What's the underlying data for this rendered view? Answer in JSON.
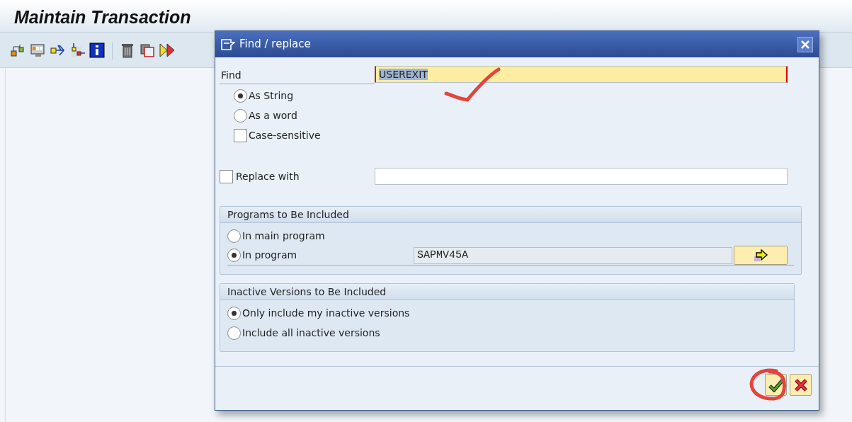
{
  "window": {
    "title": "Maintain Transaction"
  },
  "dialog": {
    "title": "Find / replace",
    "find": {
      "label": "Find",
      "value": "USEREXIT",
      "text_selected": true
    },
    "find_options": [
      {
        "kind": "radio",
        "label": "As String",
        "selected": true
      },
      {
        "kind": "radio",
        "label": "As a word",
        "selected": false
      },
      {
        "kind": "checkbox",
        "label": "Case-sensitive",
        "checked": false
      }
    ],
    "replace": {
      "label": "Replace with",
      "checked": false
    },
    "groups": [
      {
        "title": "Programs to Be Included",
        "options": [
          {
            "label": "In main program",
            "selected": false
          },
          {
            "label": "In program",
            "selected": true,
            "field_value": "SAPMV45A"
          }
        ]
      },
      {
        "title": "Inactive Versions to Be Included",
        "options": [
          {
            "label": "Only include my inactive versions",
            "selected": true
          },
          {
            "label": "Include all inactive versions",
            "selected": false
          }
        ]
      }
    ]
  }
}
